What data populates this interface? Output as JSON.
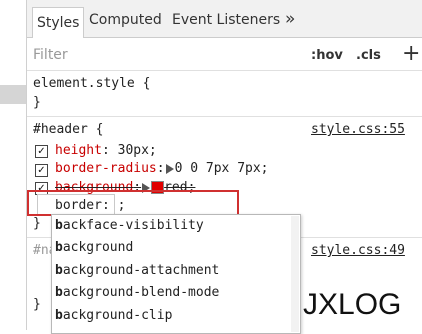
{
  "tabs": [
    {
      "label": "Styles"
    },
    {
      "label": "Computed"
    },
    {
      "label": "Event Listeners"
    }
  ],
  "overflow_label": "»",
  "filter": {
    "placeholder": "Filter",
    "hov": ":hov",
    "cls": ".cls",
    "add": "+"
  },
  "element_style": {
    "selector": "element.style {",
    "close": "}"
  },
  "rule1": {
    "selector": "#header {",
    "source": "style.css:55",
    "props": [
      {
        "name": "height",
        "value": "30px;"
      },
      {
        "name": "border-radius",
        "value": "0 0 7px 7px;"
      },
      {
        "name": "background",
        "value": "red;"
      }
    ],
    "editing_text": "border",
    "editing_suffix": ": ;",
    "close": "}"
  },
  "rule2": {
    "selector_prefix": "#na",
    "source": "style.css:49",
    "close": "}"
  },
  "autocomplete": {
    "items": [
      {
        "bold": "b",
        "rest": "ackface-visibility"
      },
      {
        "bold": "b",
        "rest": "ackground"
      },
      {
        "bold": "b",
        "rest": "ackground-attachment"
      },
      {
        "bold": "b",
        "rest": "ackground-blend-mode"
      },
      {
        "bold": "b",
        "rest": "ackground-clip"
      }
    ]
  },
  "watermark": "JXLOG",
  "colors": {
    "swatch": "#e00000",
    "highlight_box": "#d03030",
    "prop_name": "#c80000"
  }
}
